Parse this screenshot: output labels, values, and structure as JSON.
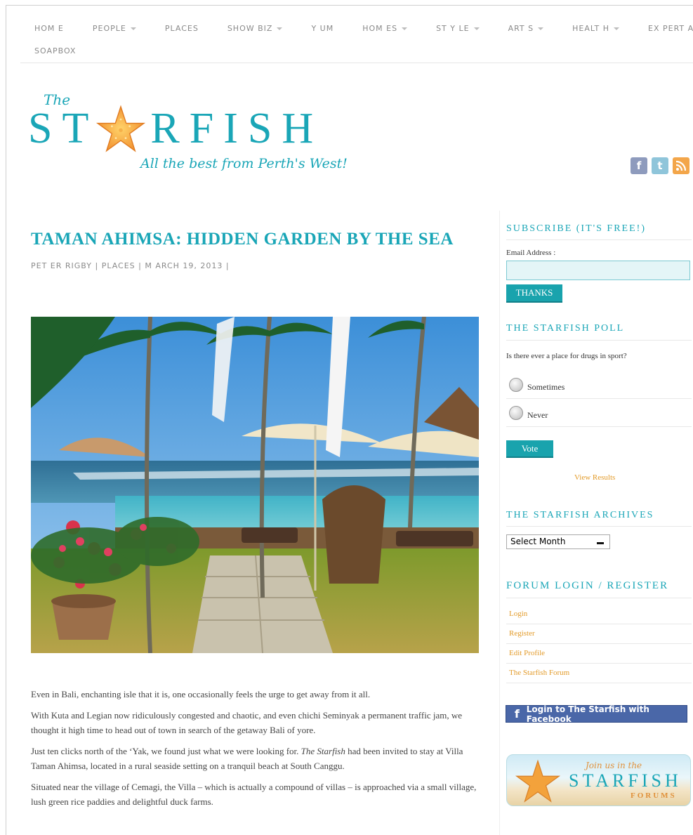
{
  "nav": {
    "items": [
      {
        "label": "HOM E",
        "dropdown": false
      },
      {
        "label": "PEOPLE",
        "dropdown": true
      },
      {
        "label": "PLACES",
        "dropdown": false
      },
      {
        "label": "SHOW BIZ",
        "dropdown": true
      },
      {
        "label": "Y UM",
        "dropdown": false
      },
      {
        "label": "HOM ES",
        "dropdown": true
      },
      {
        "label": "ST Y LE",
        "dropdown": true
      },
      {
        "label": "ART S",
        "dropdown": true
      },
      {
        "label": "HEALT H",
        "dropdown": true
      },
      {
        "label": "EX PERT ADVICE",
        "dropdown": false
      }
    ],
    "row2": [
      {
        "label": "SOAPBOX",
        "dropdown": false
      }
    ]
  },
  "logo": {
    "the": "The",
    "letters_before": "ST",
    "letters_after": "RFISH",
    "tagline": "All the best from Perth's West!"
  },
  "social": {
    "facebook": "f",
    "twitter": "t",
    "rss": "rss"
  },
  "post": {
    "title": "TAMAN AHIMSA: HIDDEN GARDEN BY THE SEA",
    "author": "PET ER RIGBY",
    "category": "PLACES",
    "date": "M ARCH 19, 2013",
    "sep": "|",
    "paragraphs": {
      "p1": "Even in Bali, enchanting isle that it is, one occasionally feels the urge to get away from it all.",
      "p2": "With Kuta and Legian now ridiculously congested and chaotic, and even chichi Seminyak a permanent traffic jam, we thought it high time to head out of town in search of the getaway Bali of yore.",
      "p3_a": "Just ten clicks north of the ‘Yak, we found just what we were looking for. ",
      "p3_em": "The Starfish",
      "p3_b": " had been invited to stay at Villa Taman Ahimsa, located in a rural seaside setting on a tranquil beach at South Canggu.",
      "p4": "Situated near the village of Cemagi, the Villa – which is actually a compound of villas – is approached via a small village, lush green rice paddies and delightful duck farms."
    }
  },
  "sidebar": {
    "subscribe": {
      "title": "SUBSCRIBE (IT'S FREE!)",
      "email_label": "Email Address :",
      "email_value": "",
      "button": "THANKS"
    },
    "poll": {
      "title": "THE STARFISH POLL",
      "question": "Is there ever a place for drugs in sport?",
      "options": [
        "Sometimes",
        "Never"
      ],
      "vote": "Vote",
      "view_results": "View Results"
    },
    "archives": {
      "title": "THE STARFISH ARCHIVES",
      "select": "Select Month"
    },
    "forum": {
      "title": "FORUM LOGIN / REGISTER",
      "links": [
        "Login",
        "Register",
        "Edit Profile",
        "The Starfish Forum"
      ]
    },
    "facebook_login": "Login to The Starfish with Facebook",
    "banner": {
      "join": "Join us in the",
      "word": "STARFISH",
      "forums": "FORUMS"
    }
  },
  "colors": {
    "accent": "#1aa6b7",
    "link_orange": "#e39b2a",
    "facebook": "#4a67a8"
  }
}
